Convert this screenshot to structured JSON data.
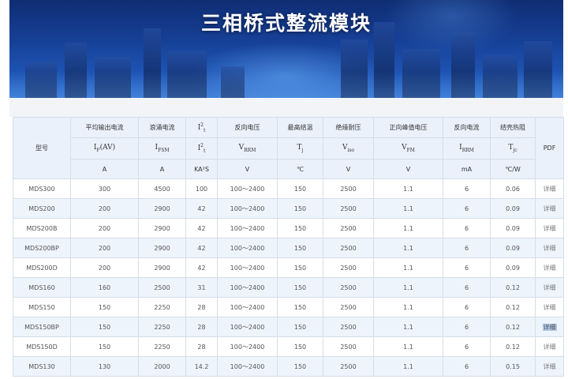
{
  "banner": {
    "title": "三相桥式整流模块"
  },
  "table": {
    "model_header": "型号",
    "pdf_header": "PDF",
    "columns": [
      {
        "name": "平均输出电流",
        "sym": "I",
        "sub": "F",
        "tail": "(AV)",
        "unit": "A"
      },
      {
        "name": "浪涌电流",
        "sym": "I",
        "sub": "FSM",
        "tail": "",
        "unit": "A"
      },
      {
        "name": "I²t",
        "sym": "I",
        "sup": "2",
        "sub2": "t",
        "unit": "KA²S",
        "name_is_symbol": true
      },
      {
        "name": "反向电压",
        "sym": "V",
        "sub": "RRM",
        "tail": "",
        "unit": "V"
      },
      {
        "name": "最高结温",
        "sym": "T",
        "sub": "j",
        "tail": "",
        "unit": "℃"
      },
      {
        "name": "绝缘耐压",
        "sym": "V",
        "sub": "iso",
        "tail": "",
        "unit": "V"
      },
      {
        "name": "正向峰值电压",
        "sym": "V",
        "sub": "FM",
        "tail": "",
        "unit": "V"
      },
      {
        "name": "反向电流",
        "sym": "I",
        "sub": "RRM",
        "tail": "",
        "unit": "mA"
      },
      {
        "name": "结壳热阻",
        "sym": "T",
        "sub": "jc",
        "tail": "",
        "unit": "℃/W"
      }
    ],
    "rows": [
      {
        "model": "MDS300",
        "vals": [
          "300",
          "4500",
          "100",
          "100～2400",
          "150",
          "2500",
          "1.1",
          "6",
          "0.06"
        ],
        "pdf": "详细"
      },
      {
        "model": "MDS200",
        "vals": [
          "200",
          "2900",
          "42",
          "100～2400",
          "150",
          "2500",
          "1.1",
          "6",
          "0.09"
        ],
        "pdf": "详细"
      },
      {
        "model": "MDS200B",
        "vals": [
          "200",
          "2900",
          "42",
          "100～2400",
          "150",
          "2500",
          "1.1",
          "6",
          "0.09"
        ],
        "pdf": "详细"
      },
      {
        "model": "MDS200BP",
        "vals": [
          "200",
          "2900",
          "42",
          "100～2400",
          "150",
          "2500",
          "1.1",
          "6",
          "0.09"
        ],
        "pdf": "详细"
      },
      {
        "model": "MDS200D",
        "vals": [
          "200",
          "2900",
          "42",
          "100～2400",
          "150",
          "2500",
          "1.1",
          "6",
          "0.09"
        ],
        "pdf": "详细"
      },
      {
        "model": "MDS160",
        "vals": [
          "160",
          "2500",
          "31",
          "100～2400",
          "150",
          "2500",
          "1.1",
          "6",
          "0.12"
        ],
        "pdf": "详细"
      },
      {
        "model": "MDS150",
        "vals": [
          "150",
          "2250",
          "28",
          "100～2400",
          "150",
          "2500",
          "1.1",
          "6",
          "0.12"
        ],
        "pdf": "详细"
      },
      {
        "model": "MDS150BP",
        "vals": [
          "150",
          "2250",
          "28",
          "100～2400",
          "150",
          "2500",
          "1.1",
          "6",
          "0.12"
        ],
        "pdf": "详细",
        "selected": true
      },
      {
        "model": "MDS150D",
        "vals": [
          "150",
          "2250",
          "28",
          "100～2400",
          "150",
          "2500",
          "1.1",
          "6",
          "0.12"
        ],
        "pdf": "详细"
      },
      {
        "model": "MDS130",
        "vals": [
          "130",
          "2000",
          "14.2",
          "100～2400",
          "150",
          "2500",
          "1.1",
          "6",
          "0.15"
        ],
        "pdf": "详细"
      }
    ]
  },
  "colors": {
    "header_bg": "#eaf1fb",
    "row_alt_bg": "#eef4fc",
    "border": "#d6dde8",
    "banner_blue": "#163f95"
  }
}
